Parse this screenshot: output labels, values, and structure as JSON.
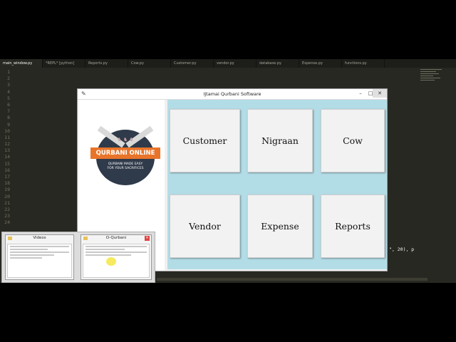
{
  "editor": {
    "tabs": [
      "main_window.py",
      "*REPL* [python]",
      "Reports.py",
      "Cow.py",
      "Customer.py",
      "vendor.py",
      "database.py",
      "Expense.py",
      "functions.py"
    ],
    "line_numbers": [
      "1",
      "2",
      "3",
      "4",
      "5",
      "6",
      "7",
      "8",
      "9",
      "10",
      "11",
      "12",
      "13",
      "14",
      "15",
      "16",
      "17",
      "18",
      "19",
      "20",
      "21",
      "22",
      "23",
      "24"
    ],
    "tail_text": "\", 20), p"
  },
  "app_window": {
    "title": "Ijtamai Qurbani Software",
    "logo": {
      "banner": "QURBANI ONLINE",
      "tagline_1": "QURBANI MADE EASY",
      "tagline_2": "FOR YOUR SACRIFICES"
    },
    "buttons": [
      "Customer",
      "Nigraan",
      "Cow",
      "Vendor",
      "Expense",
      "Reports"
    ]
  },
  "taskbar_preview": {
    "items": [
      {
        "title": "Videos"
      },
      {
        "title": "O-Qurbani"
      }
    ]
  },
  "colors": {
    "editor_bg": "#272822",
    "tile_bg": "#f2f2f2",
    "panel_bg": "#b3dde6",
    "banner": "#e8742a"
  }
}
